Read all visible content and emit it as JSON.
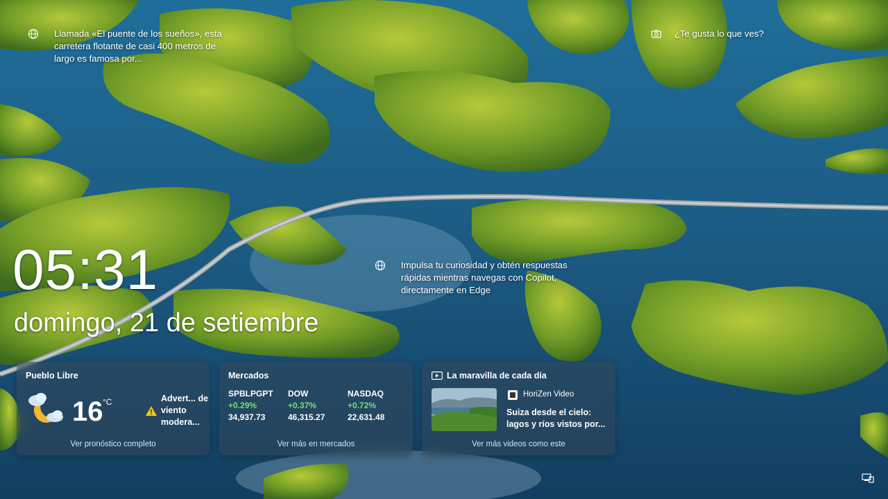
{
  "spotlight": {
    "description": "Llamada «El puente de los sueños», esta carretera flotante de casi 400 metros de largo es famosa por...",
    "like_prompt": "¿Te gusta lo que ves?"
  },
  "copilot_tip": "Impulsa tu curiosidad y obtén respuestas rápidas mientras navegas con Copilot, directamente en Edge",
  "clock": {
    "time": "05:31",
    "date": "domingo, 21 de setiembre"
  },
  "weather": {
    "location": "Pueblo Libre",
    "temperature": "16",
    "unit": "°C",
    "alert": "Advert... de viento modera...",
    "link": "Ver pronóstico completo",
    "icon": "partly-cloudy-night-icon"
  },
  "markets": {
    "title": "Mercados",
    "items": [
      {
        "name": "SPBLPGPT",
        "change": "+0.29%",
        "value": "34,937.73"
      },
      {
        "name": "DOW",
        "change": "+0.37%",
        "value": "46,315.27"
      },
      {
        "name": "NASDAQ",
        "change": "+0.72%",
        "value": "22,631.48"
      }
    ],
    "link": "Ver más en mercados",
    "positive_color": "#6ee07a"
  },
  "video": {
    "title": "La maravilla de cada día",
    "source": "HoriZen Video",
    "headline": "Suiza desde el cielo: lagos y ríos vistos por...",
    "link": "Ver más videos como este"
  }
}
